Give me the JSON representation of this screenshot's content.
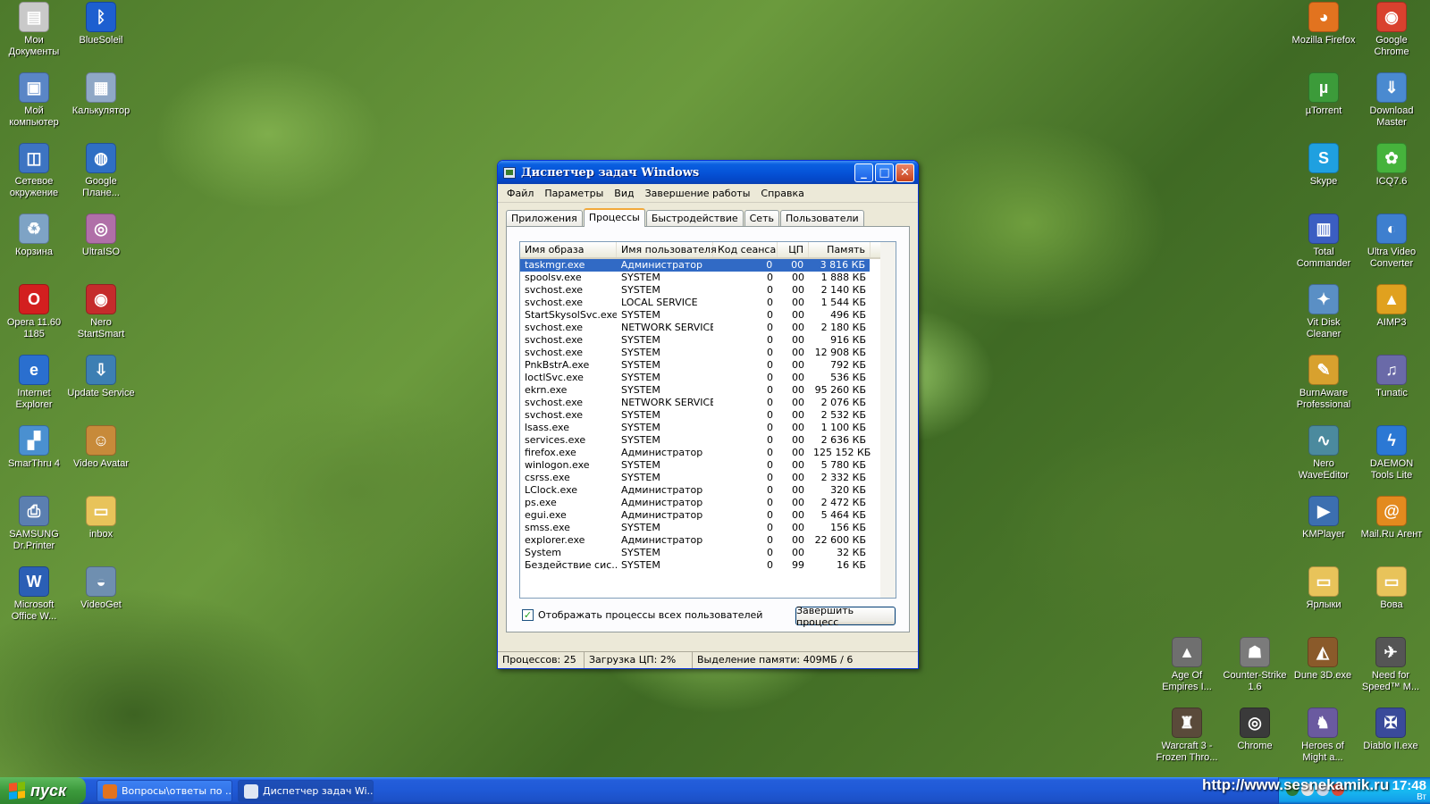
{
  "desktop": {
    "left_icons": [
      {
        "label": "Мои Документы",
        "glyph": "folder-docs-icon",
        "color": "#c9c9c9",
        "ch": "▤"
      },
      {
        "label": "BlueSoleil",
        "glyph": "bluetooth-icon",
        "color": "#1d5fd0",
        "ch": "ᛒ"
      },
      {
        "label": "Мой компьютер",
        "glyph": "computer-icon",
        "color": "#5a86c6",
        "ch": "▣"
      },
      {
        "label": "Калькулятор",
        "glyph": "calculator-icon",
        "color": "#8fa8c6",
        "ch": "▦"
      },
      {
        "label": "Сетевое окружение",
        "glyph": "network-icon",
        "color": "#3d74c2",
        "ch": "◫"
      },
      {
        "label": "Google Плане...",
        "glyph": "google-earth-icon",
        "color": "#2f6fc4",
        "ch": "◍"
      },
      {
        "label": "Корзина",
        "glyph": "recycle-bin-icon",
        "color": "#7ea3c5",
        "ch": "♻"
      },
      {
        "label": "UltraISO",
        "glyph": "disc-icon",
        "color": "#b06fa8",
        "ch": "◎"
      },
      {
        "label": "Opera 11.60 1185",
        "glyph": "opera-icon",
        "color": "#d31f1f",
        "ch": "O"
      },
      {
        "label": "Nero StartSmart",
        "glyph": "nero-icon",
        "color": "#c52c2c",
        "ch": "◉"
      },
      {
        "label": "Internet Explorer",
        "glyph": "ie-icon",
        "color": "#2a6fcf",
        "ch": "e"
      },
      {
        "label": "Update Service",
        "glyph": "update-icon",
        "color": "#3d7fb3",
        "ch": "⇩"
      },
      {
        "label": "SmarThru 4",
        "glyph": "smarthru-icon",
        "color": "#4a90d0",
        "ch": "▞"
      },
      {
        "label": "Video Avatar",
        "glyph": "video-avatar-icon",
        "color": "#c78a3a",
        "ch": "☺"
      },
      {
        "label": "SAMSUNG Dr.Printer",
        "glyph": "printer-icon",
        "color": "#5b7fb0",
        "ch": "⎙"
      },
      {
        "label": "inbox",
        "glyph": "folder-icon",
        "color": "#e8c35a",
        "ch": "▭"
      },
      {
        "label": "Microsoft Office W...",
        "glyph": "word-icon",
        "color": "#2b5fb5",
        "ch": "W"
      },
      {
        "label": "VideoGet",
        "glyph": "videoget-icon",
        "color": "#6f8fb0",
        "ch": "◒"
      }
    ],
    "right_icons": [
      {
        "label": "Mozilla Firefox",
        "glyph": "firefox-icon",
        "color": "#e2731f",
        "ch": "◕"
      },
      {
        "label": "Google Chrome",
        "glyph": "chrome-icon",
        "color": "#d9412e",
        "ch": "◉"
      },
      {
        "label": "µTorrent",
        "glyph": "utorrent-icon",
        "color": "#3c9b3a",
        "ch": "µ"
      },
      {
        "label": "Download Master",
        "glyph": "download-master-icon",
        "color": "#4a8ad0",
        "ch": "⇓"
      },
      {
        "label": "Skype",
        "glyph": "skype-icon",
        "color": "#1fa0e0",
        "ch": "S"
      },
      {
        "label": "ICQ7.6",
        "glyph": "icq-icon",
        "color": "#46b33c",
        "ch": "✿"
      },
      {
        "label": "Total Commander",
        "glyph": "total-commander-icon",
        "color": "#3b5ec2",
        "ch": "▥"
      },
      {
        "label": "Ultra Video Converter",
        "glyph": "video-converter-icon",
        "color": "#3e7fcf",
        "ch": "◐"
      },
      {
        "label": "Vit Disk Cleaner",
        "glyph": "disk-cleaner-icon",
        "color": "#5a8fc5",
        "ch": "✦"
      },
      {
        "label": "AIMP3",
        "glyph": "aimp-icon",
        "color": "#e0a11f",
        "ch": "▲"
      },
      {
        "label": "BurnAware Professional",
        "glyph": "burnaware-icon",
        "color": "#d8a12e",
        "ch": "✎"
      },
      {
        "label": "Tunatic",
        "glyph": "tunatic-icon",
        "color": "#6a6aa8",
        "ch": "♫"
      },
      {
        "label": "Nero WaveEditor",
        "glyph": "nero-wave-icon",
        "color": "#4b8a9e",
        "ch": "∿"
      },
      {
        "label": "DAEMON Tools Lite",
        "glyph": "daemon-tools-icon",
        "color": "#2b78d4",
        "ch": "ϟ"
      },
      {
        "label": "KMPlayer",
        "glyph": "kmplayer-icon",
        "color": "#3c6fb0",
        "ch": "▶"
      },
      {
        "label": "Mail.Ru Агент",
        "glyph": "mailru-icon",
        "color": "#e38a1e",
        "ch": "@"
      },
      {
        "label": "Ярлыки",
        "glyph": "folder-shortcuts-icon",
        "color": "#e8c35a",
        "ch": "▭"
      },
      {
        "label": "Вова",
        "glyph": "folder-vova-icon",
        "color": "#e8c35a",
        "ch": "▭"
      }
    ],
    "bottom_icons": [
      {
        "label": "Age Of Empires I...",
        "glyph": "age-of-empires-icon",
        "color": "#6f6f6f",
        "ch": "▲"
      },
      {
        "label": "Counter-Strike 1.6",
        "glyph": "counter-strike-icon",
        "color": "#7b7b7b",
        "ch": "☗"
      },
      {
        "label": "Dune 3D.exe",
        "glyph": "dune-icon",
        "color": "#8a5a2a",
        "ch": "◭"
      },
      {
        "label": "Need for Speed™ M...",
        "glyph": "nfs-icon",
        "color": "#555555",
        "ch": "✈"
      },
      {
        "label": "Warcraft 3 - Frozen Thro...",
        "glyph": "warcraft-icon",
        "color": "#5a4a3a",
        "ch": "♜"
      },
      {
        "label": "Chrome",
        "glyph": "chrome-game-icon",
        "color": "#3a3a3a",
        "ch": "◎"
      },
      {
        "label": "Heroes of Might a...",
        "glyph": "heroes-icon",
        "color": "#6a5aa0",
        "ch": "♞"
      },
      {
        "label": "Diablo II.exe",
        "glyph": "diablo-icon",
        "color": "#3a4a9a",
        "ch": "✠"
      }
    ]
  },
  "window": {
    "title": "Диспетчер задач Windows",
    "buttons": {
      "minimize": "_",
      "maximize": "□",
      "close": "✕"
    },
    "menu": [
      "Файл",
      "Параметры",
      "Вид",
      "Завершение работы",
      "Справка"
    ],
    "tabs": [
      {
        "label": "Приложения",
        "active": false
      },
      {
        "label": "Процессы",
        "active": true
      },
      {
        "label": "Быстродействие",
        "active": false
      },
      {
        "label": "Сеть",
        "active": false
      },
      {
        "label": "Пользователи",
        "active": false
      }
    ],
    "columns": [
      "Имя образа",
      "Имя пользователя",
      "Код сеанса",
      "ЦП",
      "Память"
    ],
    "processes": [
      [
        "taskmgr.exe",
        "Администратор",
        "0",
        "00",
        "3 816 КБ"
      ],
      [
        "spoolsv.exe",
        "SYSTEM",
        "0",
        "00",
        "1 888 КБ"
      ],
      [
        "svchost.exe",
        "SYSTEM",
        "0",
        "00",
        "2 140 КБ"
      ],
      [
        "svchost.exe",
        "LOCAL SERVICE",
        "0",
        "00",
        "1 544 КБ"
      ],
      [
        "StartSkysolSvc.exe",
        "SYSTEM",
        "0",
        "00",
        "496 КБ"
      ],
      [
        "svchost.exe",
        "NETWORK SERVICE",
        "0",
        "00",
        "2 180 КБ"
      ],
      [
        "svchost.exe",
        "SYSTEM",
        "0",
        "00",
        "916 КБ"
      ],
      [
        "svchost.exe",
        "SYSTEM",
        "0",
        "00",
        "12 908 КБ"
      ],
      [
        "PnkBstrA.exe",
        "SYSTEM",
        "0",
        "00",
        "792 КБ"
      ],
      [
        "IoctlSvc.exe",
        "SYSTEM",
        "0",
        "00",
        "536 КБ"
      ],
      [
        "ekrn.exe",
        "SYSTEM",
        "0",
        "00",
        "95 260 КБ"
      ],
      [
        "svchost.exe",
        "NETWORK SERVICE",
        "0",
        "00",
        "2 076 КБ"
      ],
      [
        "svchost.exe",
        "SYSTEM",
        "0",
        "00",
        "2 532 КБ"
      ],
      [
        "lsass.exe",
        "SYSTEM",
        "0",
        "00",
        "1 100 КБ"
      ],
      [
        "services.exe",
        "SYSTEM",
        "0",
        "00",
        "2 636 КБ"
      ],
      [
        "firefox.exe",
        "Администратор",
        "0",
        "00",
        "125 152 КБ"
      ],
      [
        "winlogon.exe",
        "SYSTEM",
        "0",
        "00",
        "5 780 КБ"
      ],
      [
        "csrss.exe",
        "SYSTEM",
        "0",
        "00",
        "2 332 КБ"
      ],
      [
        "LClock.exe",
        "Администратор",
        "0",
        "00",
        "320 КБ"
      ],
      [
        "ps.exe",
        "Администратор",
        "0",
        "00",
        "2 472 КБ"
      ],
      [
        "egui.exe",
        "Администратор",
        "0",
        "00",
        "5 464 КБ"
      ],
      [
        "smss.exe",
        "SYSTEM",
        "0",
        "00",
        "156 КБ"
      ],
      [
        "explorer.exe",
        "Администратор",
        "0",
        "00",
        "22 600 КБ"
      ],
      [
        "System",
        "SYSTEM",
        "0",
        "00",
        "32 КБ"
      ],
      [
        "Бездействие сис...",
        "SYSTEM",
        "0",
        "99",
        "16 КБ"
      ]
    ],
    "selected_index": 0,
    "show_all_users": {
      "label": "Отображать процессы всех пользователей",
      "checked": true
    },
    "end_process_label": "Завершить процесс",
    "status": {
      "processes": "Процессов: 25",
      "cpu": "Загрузка ЦП: 2%",
      "memory": "Выделение памяти: 409МБ / 6"
    }
  },
  "taskbar": {
    "start_label": "пуск",
    "tasks": [
      {
        "label": "Вопросы\\ответы по ...",
        "icon": "firefox-task-icon",
        "color": "#e2731f",
        "active": false
      },
      {
        "label": "Диспетчер задач Wi...",
        "icon": "taskmgr-task-icon",
        "color": "#dfe6f3",
        "active": true
      }
    ],
    "watermark": "http://www.sesnekamik.ru",
    "clock": {
      "time": "17:48",
      "day": "Вт"
    }
  },
  "colors": {
    "selection": "#316ac5",
    "titlebar": "#0553d8",
    "taskbar": "#245edb",
    "start": "#3c9a3c"
  }
}
